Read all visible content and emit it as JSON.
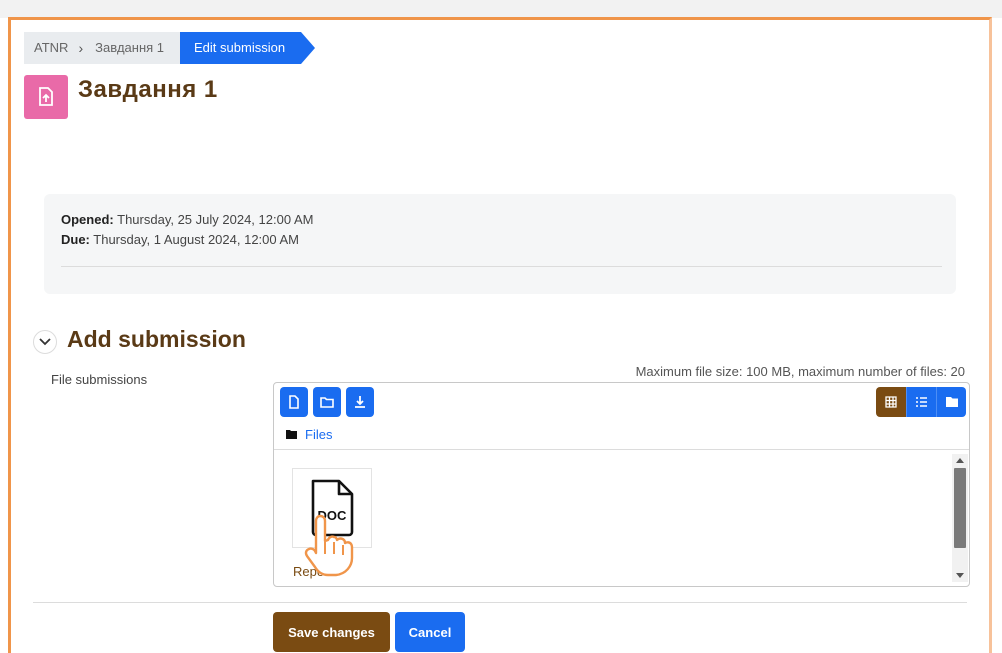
{
  "breadcrumb": {
    "items": [
      "ATNR",
      "Завдання 1"
    ],
    "active": "Edit submission"
  },
  "page": {
    "title": "Завдання 1",
    "icon": "assignment-upload-icon",
    "icon_color": "#e96aa8"
  },
  "dates": {
    "opened_label": "Opened:",
    "opened_value": "Thursday, 25 July 2024, 12:00 AM",
    "due_label": "Due:",
    "due_value": "Thursday, 1 August 2024, 12:00 AM"
  },
  "section": {
    "title": "Add submission",
    "field_label": "File submissions",
    "max_info": "Maximum file size: 100 MB, maximum number of files: 20"
  },
  "filemanager": {
    "toolbar": [
      "add-file-icon",
      "create-folder-icon",
      "download-icon"
    ],
    "views": [
      "grid-view-icon",
      "list-view-icon",
      "tree-view-icon"
    ],
    "path_label": "Files",
    "file": {
      "icon": "doc-file-icon",
      "icon_text": "DOC",
      "name": "Repo"
    }
  },
  "buttons": {
    "save": "Save changes",
    "cancel": "Cancel"
  },
  "colors": {
    "primary": "#1a6cf0",
    "brand_brown": "#7a4b12",
    "title_brown": "#5a3a16",
    "frame_orange": "#f0954a"
  }
}
